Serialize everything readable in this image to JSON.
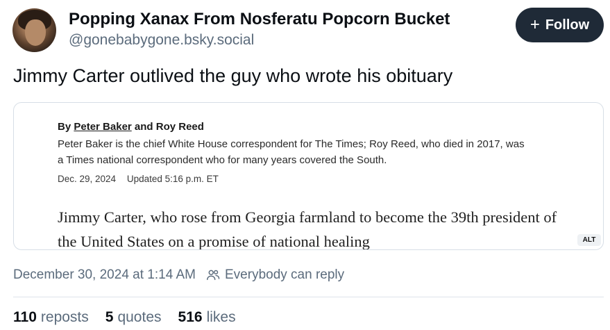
{
  "author": {
    "display_name": "Popping Xanax From Nosferatu Popcorn Bucket",
    "handle": "@gonebabygone.bsky.social"
  },
  "follow_button": {
    "label": "Follow",
    "icon": "plus-icon"
  },
  "post": {
    "text": "Jimmy Carter outlived the guy who wrote his obituary"
  },
  "embed_image": {
    "byline_prefix": "By",
    "byline_author": "Peter Baker",
    "byline_rest": "and Roy Reed",
    "bio": "Peter Baker is the chief White House correspondent for The Times; Roy Reed, who died in 2017, was a Times national correspondent who for many years covered the South.",
    "date": "Dec. 29, 2024",
    "updated": "Updated 5:16 p.m. ET",
    "lede": "Jimmy Carter, who rose from Georgia farmland to become the 39th president of the United States on a promise of national healing",
    "alt_badge": "ALT"
  },
  "meta": {
    "timestamp": "December 30, 2024 at 1:14 AM",
    "reply_setting": "Everybody can reply",
    "reply_icon": "people-icon"
  },
  "stats": {
    "reposts_count": "110",
    "reposts_label": "reposts",
    "quotes_count": "5",
    "quotes_label": "quotes",
    "likes_count": "516",
    "likes_label": "likes"
  }
}
